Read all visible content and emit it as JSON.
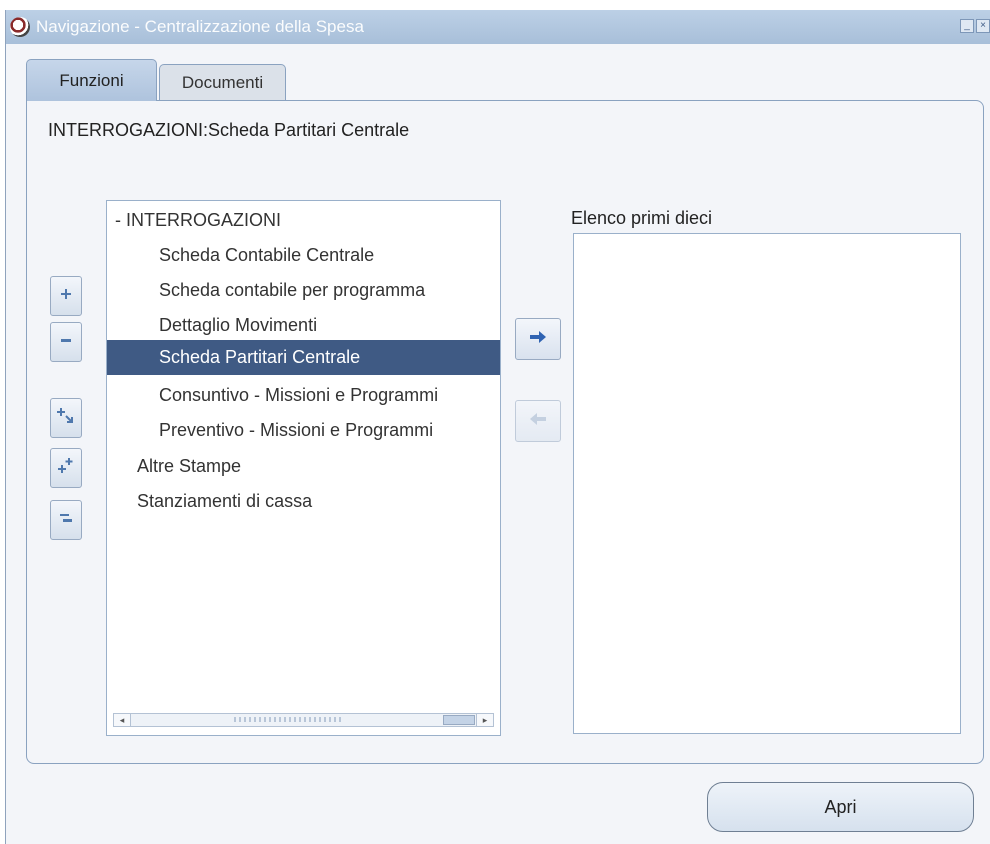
{
  "window": {
    "title": "Navigazione - Centralizzazione della Spesa"
  },
  "tabs": [
    {
      "label": "Funzioni",
      "active": true
    },
    {
      "label": "Documenti",
      "active": false
    }
  ],
  "selected_path": "INTERROGAZIONI:Scheda Partitari Centrale",
  "tools": [
    {
      "icon": "expand-icon"
    },
    {
      "icon": "collapse-icon"
    },
    {
      "icon": "expand-branch-icon"
    },
    {
      "icon": "expand-all-icon"
    },
    {
      "icon": "collapse-all-icon"
    }
  ],
  "tree": {
    "items": [
      {
        "label": "-  INTERROGAZIONI",
        "level": 0
      },
      {
        "label": "Scheda Contabile Centrale",
        "level": 2
      },
      {
        "label": "Scheda contabile per programma",
        "level": 2
      },
      {
        "label": "Dettaglio Movimenti",
        "level": 2
      },
      {
        "label": "Scheda Partitari Centrale",
        "level": 2,
        "selected": true
      },
      {
        "label": "Consuntivo - Missioni e Programmi",
        "level": 2
      },
      {
        "label": "Preventivo - Missioni e Programmi",
        "level": 2
      },
      {
        "label": "Altre Stampe",
        "level": 1
      },
      {
        "label": "Stanziamenti di cassa",
        "level": 1
      }
    ]
  },
  "move_buttons": {
    "add_icon": "arrow-right-icon",
    "remove_icon": "arrow-left-icon"
  },
  "topten": {
    "label": "Elenco primi dieci",
    "items": []
  },
  "open_button": {
    "label": "Apri"
  },
  "colors": {
    "selection": "#3f5a84",
    "titlebar": "#a8bfd9",
    "tab_active": "#aec3dd",
    "arrow": "#2f63b2"
  }
}
